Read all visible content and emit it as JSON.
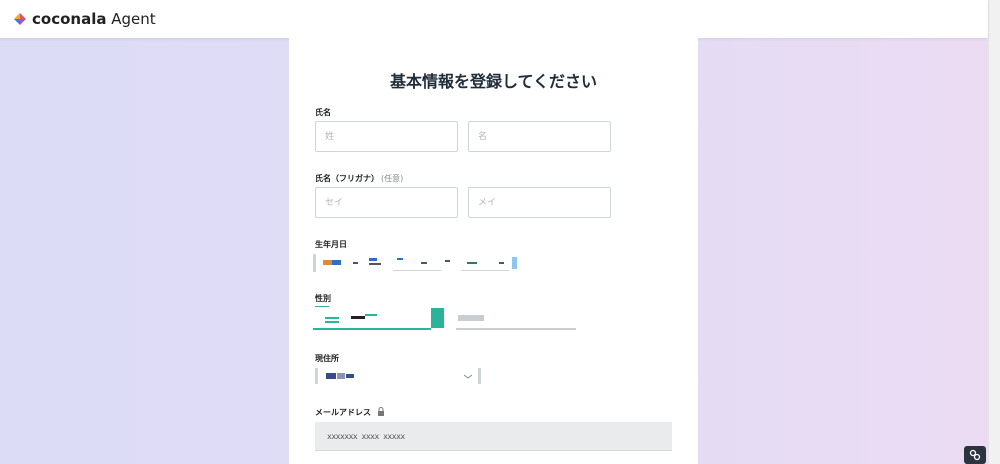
{
  "header": {
    "logo_bold": "coconala",
    "logo_light": " Agent"
  },
  "form": {
    "title": "基本情報を登録してください",
    "name_label": "氏名",
    "last_name_placeholder": "姓",
    "first_name_placeholder": "名",
    "kana_label": "氏名（フリガナ）",
    "kana_optional": "(任意)",
    "last_kana_placeholder": "セイ",
    "first_kana_placeholder": "メイ",
    "birthdate_label": "生年月日",
    "gender_label": "性別",
    "address_label": "現住所",
    "email_label": "メールアドレス",
    "email_value": "xxxxxxx xxxx xxxxx"
  },
  "icons": {
    "logo": "coconala-logo-icon",
    "lock": "lock-icon",
    "chevron": "chevron-down-icon",
    "corner": "link-icon"
  },
  "colors": {
    "accent": "#2bb39b",
    "title": "#1f2d3a",
    "background_left": "#dcdcf6",
    "background_right": "#ecdcf3"
  }
}
